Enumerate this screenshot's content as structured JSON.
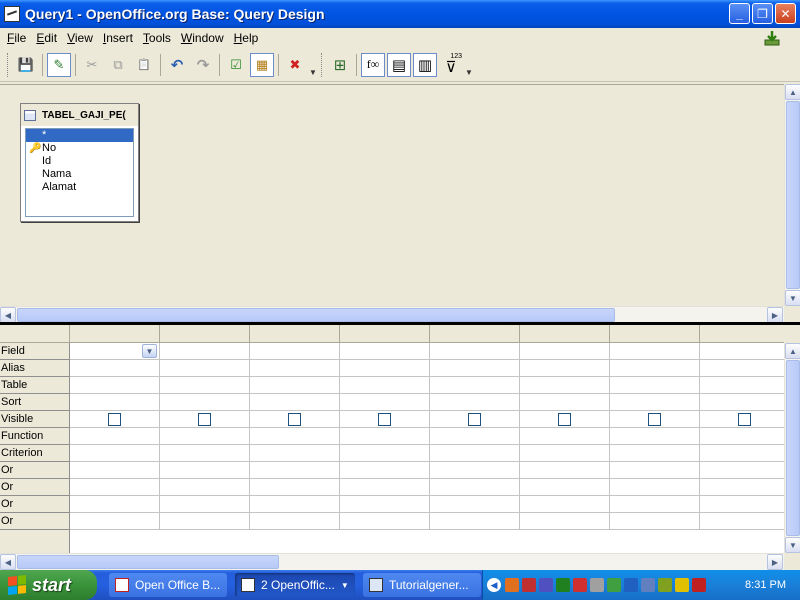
{
  "window": {
    "title": "Query1 - OpenOffice.org Base: Query Design",
    "minimize": "_",
    "maximize": "❐",
    "close": "✕"
  },
  "menu": [
    {
      "label": "File",
      "accel": "F",
      "rest": "ile"
    },
    {
      "label": "Edit",
      "accel": "E",
      "rest": "dit"
    },
    {
      "label": "View",
      "accel": "V",
      "rest": "iew"
    },
    {
      "label": "Insert",
      "accel": "I",
      "rest": "nsert"
    },
    {
      "label": "Tools",
      "accel": "T",
      "rest": "ools"
    },
    {
      "label": "Window",
      "accel": "W",
      "rest": "indow"
    },
    {
      "label": "Help",
      "accel": "H",
      "rest": "elp"
    }
  ],
  "toolbar": {
    "save": "💾",
    "edit": "✎",
    "cut": "✂",
    "copy": "⧉",
    "paste": "📋",
    "undo": "↶",
    "redo": "↷",
    "run": "☑",
    "clear": "▦",
    "delete": "✖",
    "add_table": "⊞",
    "functions": "f∞",
    "table_names": "▤",
    "alias": "▥",
    "distinct": "⊽",
    "distinct_badge": "123"
  },
  "table_window": {
    "title": "TABEL_GAJI_PE(",
    "fields": [
      "*",
      "No",
      "Id",
      "Nama",
      "Alamat"
    ],
    "selected_index": 0,
    "primary_key_index": 1
  },
  "design_grid": {
    "row_labels": [
      "Field",
      "Alias",
      "Table",
      "Sort",
      "Visible",
      "Function",
      "Criterion",
      "Or",
      "Or",
      "Or",
      "Or"
    ],
    "column_count": 8
  },
  "taskbar": {
    "start": "start",
    "tasks": [
      {
        "label": "Open Office B...",
        "active": false
      },
      {
        "label": "2 OpenOffic...",
        "active": true,
        "grouped": true
      },
      {
        "label": "Tutorialgener...",
        "active": false
      }
    ],
    "clock": "8:31 PM",
    "tray_icon_colors": [
      "#e07020",
      "#c03030",
      "#5050c0",
      "#208020",
      "#d03030",
      "#a0a0a0",
      "#40a040",
      "#2060c0",
      "#6080c0",
      "#80a020",
      "#e0c000",
      "#c02020"
    ]
  }
}
